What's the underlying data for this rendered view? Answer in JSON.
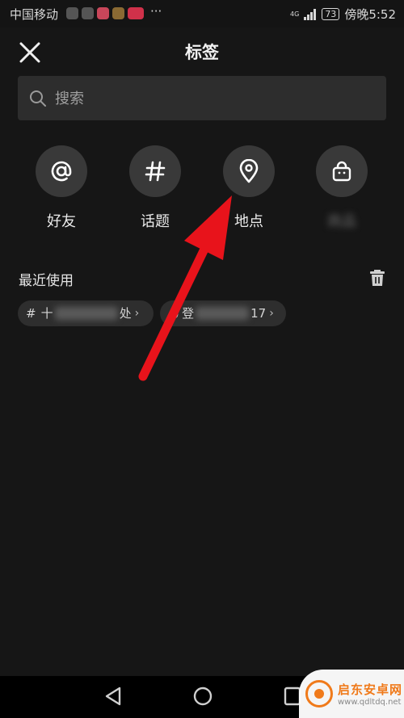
{
  "status_bar": {
    "carrier": "中国移动",
    "notif_more": "···",
    "network": "4G",
    "battery": "73",
    "time": "傍晚5:52"
  },
  "header": {
    "title": "标签",
    "close_icon": "close-icon"
  },
  "search": {
    "placeholder": "搜索",
    "value": ""
  },
  "categories": [
    {
      "label": "好友",
      "icon": "at-icon"
    },
    {
      "label": "话题",
      "icon": "hash-icon"
    },
    {
      "label": "地点",
      "icon": "location-pin-icon"
    },
    {
      "label": "商品",
      "icon": "shopping-bag-icon"
    }
  ],
  "recent": {
    "title": "最近使用",
    "chips": [
      {
        "prefix": "#",
        "start": "十",
        "end": "处"
      },
      {
        "prefix": "○",
        "start": "登",
        "end": "17"
      }
    ]
  },
  "watermark": {
    "name": "启东安卓网",
    "url": "www.qdltdq.net"
  },
  "colors": {
    "background": "#161616",
    "surface": "#393939",
    "arrow": "#e8131b"
  }
}
